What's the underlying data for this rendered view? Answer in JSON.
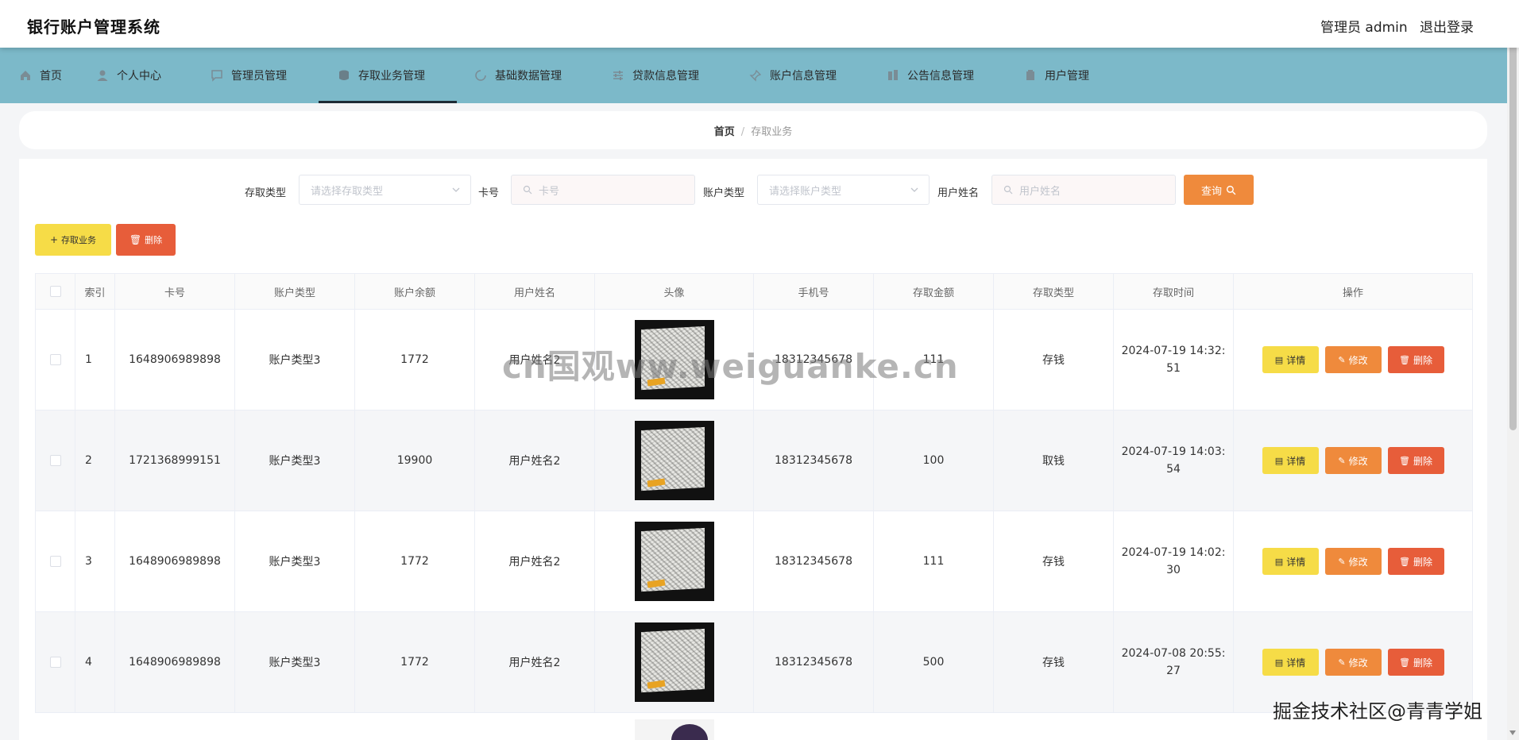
{
  "header": {
    "title": "银行账户管理系统",
    "admin": "管理员 admin",
    "logout": "退出登录"
  },
  "nav": {
    "items": [
      {
        "label": "首页",
        "icon": "home-icon"
      },
      {
        "label": "个人中心",
        "icon": "user-icon"
      },
      {
        "label": "管理员管理",
        "icon": "chat-icon"
      },
      {
        "label": "存取业务管理",
        "icon": "coin-icon"
      },
      {
        "label": "基础数据管理",
        "icon": "loading-icon"
      },
      {
        "label": "贷款信息管理",
        "icon": "sliders-icon"
      },
      {
        "label": "账户信息管理",
        "icon": "pin-icon"
      },
      {
        "label": "公告信息管理",
        "icon": "building-icon"
      },
      {
        "label": "用户管理",
        "icon": "users-icon"
      }
    ],
    "active_index": 3
  },
  "breadcrumb": {
    "home": "首页",
    "separator": "/",
    "current": "存取业务"
  },
  "filters": {
    "type_label": "存取类型",
    "type_placeholder": "请选择存取类型",
    "card_label": "卡号",
    "card_placeholder": "卡号",
    "account_type_label": "账户类型",
    "account_type_placeholder": "请选择账户类型",
    "username_label": "用户姓名",
    "username_placeholder": "用户姓名",
    "query_button": "查询"
  },
  "actions": {
    "add_button": "存取业务",
    "delete_button": "删除"
  },
  "table": {
    "headers": [
      "索引",
      "卡号",
      "账户类型",
      "账户余额",
      "用户姓名",
      "头像",
      "手机号",
      "存取金额",
      "存取类型",
      "存取时间",
      "操作"
    ],
    "row_buttons": {
      "detail": "详情",
      "edit": "修改",
      "delete": "删除"
    },
    "rows": [
      {
        "index": "1",
        "card": "1648906989898",
        "account_type": "账户类型3",
        "balance": "1772",
        "username": "用户姓名2",
        "phone": "18312345678",
        "amount": "111",
        "type": "存钱",
        "time": "2024-07-19 14:32:51"
      },
      {
        "index": "2",
        "card": "1721368999151",
        "account_type": "账户类型3",
        "balance": "19900",
        "username": "用户姓名2",
        "phone": "18312345678",
        "amount": "100",
        "type": "取钱",
        "time": "2024-07-19 14:03:54"
      },
      {
        "index": "3",
        "card": "1648906989898",
        "account_type": "账户类型3",
        "balance": "1772",
        "username": "用户姓名2",
        "phone": "18312345678",
        "amount": "111",
        "type": "存钱",
        "time": "2024-07-19 14:02:30"
      },
      {
        "index": "4",
        "card": "1648906989898",
        "account_type": "账户类型3",
        "balance": "1772",
        "username": "用户姓名2",
        "phone": "18312345678",
        "amount": "500",
        "type": "存钱",
        "time": "2024-07-08 20:55:27"
      }
    ]
  },
  "watermarks": {
    "center": "cn国观ww.weiguanke.cn",
    "corner": "掘金技术社区@青青学姐"
  },
  "colors": {
    "nav_bg": "#7cb9c9",
    "yellow": "#f6dc47",
    "orange": "#ef8a3c",
    "red": "#e75d3a"
  }
}
